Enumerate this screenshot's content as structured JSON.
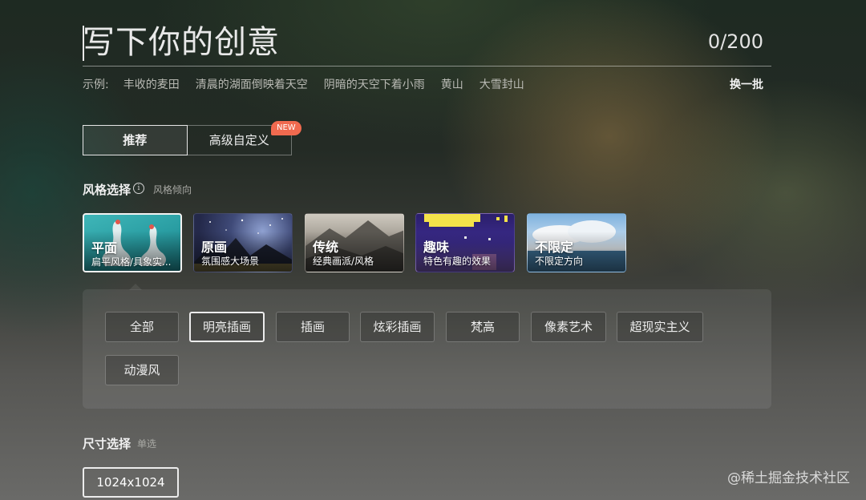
{
  "prompt": {
    "placeholder": "写下你的创意",
    "char_count": "0/200"
  },
  "examples": {
    "label": "示例:",
    "items": [
      "丰收的麦田",
      "清晨的湖面倒映着天空",
      "阴暗的天空下着小雨",
      "黄山",
      "大雪封山"
    ],
    "refresh_label": "换一批"
  },
  "tabs": {
    "recommend": "推荐",
    "advanced": "高级自定义",
    "new_badge": "NEW"
  },
  "style_section": {
    "title": "风格选择",
    "subtitle": "风格倾向"
  },
  "style_cards": [
    {
      "title": "平面",
      "desc": "扁平风格/具象实..."
    },
    {
      "title": "原画",
      "desc": "氛围感大场景"
    },
    {
      "title": "传统",
      "desc": "经典画派/风格"
    },
    {
      "title": "趣味",
      "desc": "特色有趣的效果"
    },
    {
      "title": "不限定",
      "desc": "不限定方向"
    }
  ],
  "sub_styles": [
    "全部",
    "明亮插画",
    "插画",
    "炫彩插画",
    "梵高",
    "像素艺术",
    "超现实主义",
    "动漫风"
  ],
  "size_section": {
    "title": "尺寸选择",
    "subtitle": "单选",
    "options": [
      "1024x1024"
    ]
  },
  "watermark": "@稀土掘金技术社区",
  "colors": {
    "badge": "#f06a4f",
    "selected_border": "#ececec"
  }
}
